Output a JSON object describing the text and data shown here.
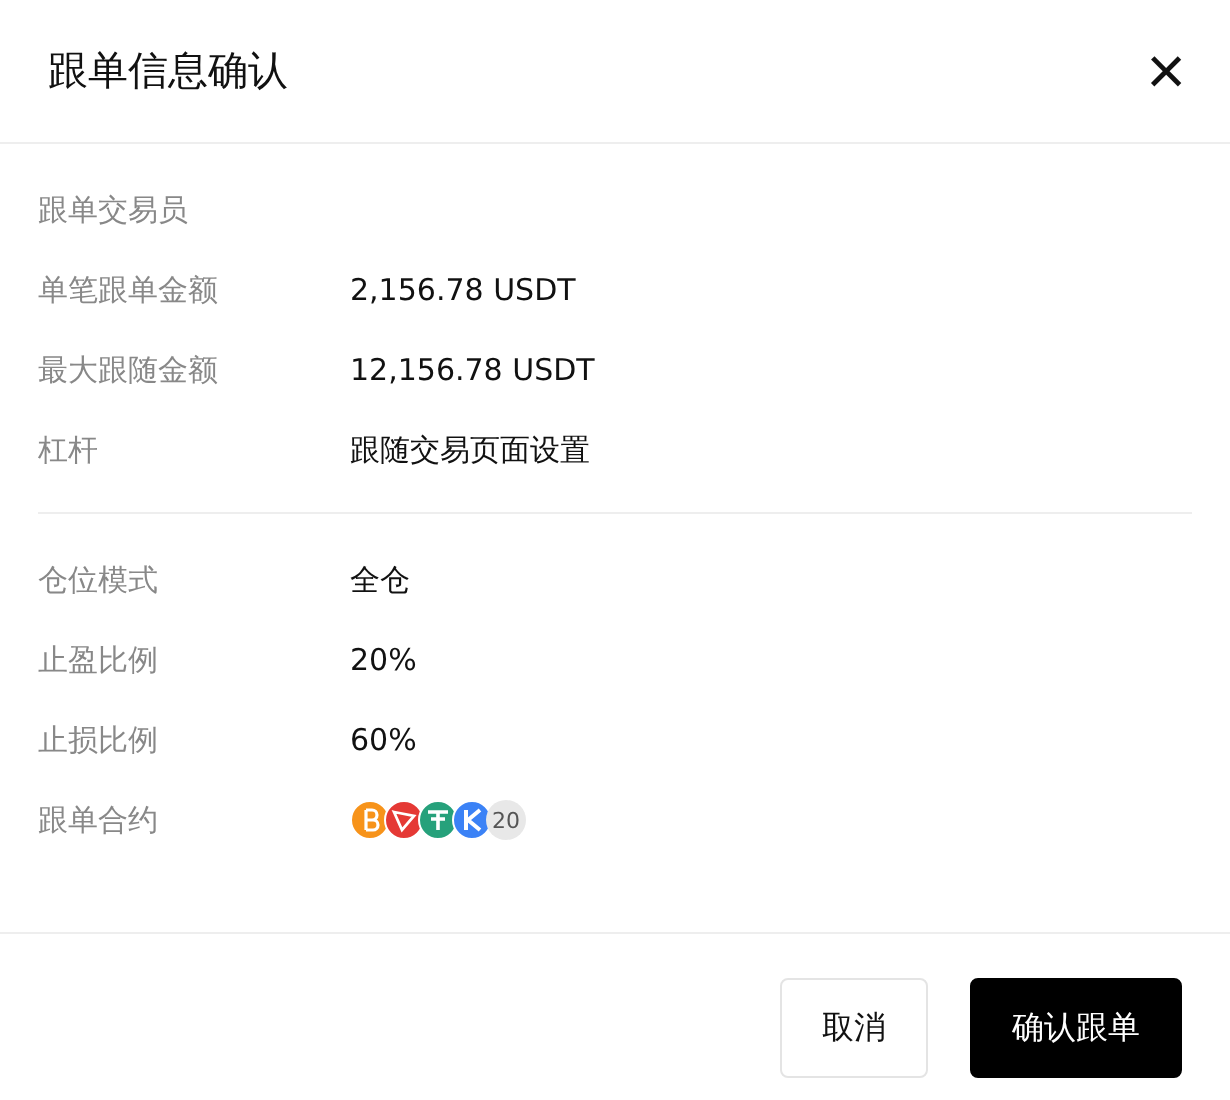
{
  "dialog": {
    "title": "跟单信息确认",
    "close": "×"
  },
  "sections": [
    {
      "rows": [
        {
          "label": "跟单交易员"
        },
        {
          "label": "单笔跟单金额",
          "value": "2,156.78 USDT"
        },
        {
          "label": "最大跟随金额",
          "value": "12,156.78 USDT"
        },
        {
          "label": "杠杆",
          "value": "跟随交易页面设置"
        }
      ]
    },
    {
      "rows": [
        {
          "label": "仓位模式",
          "value": "全仓"
        },
        {
          "label": "止盈比例",
          "value": "20%"
        },
        {
          "label": "止损比例",
          "value": "60%"
        },
        {
          "label": "跟单合约",
          "coins": [
            {
              "color": "#f7931a"
            },
            {
              "color": "#e53935"
            },
            {
              "color": "#26a17b"
            },
            {
              "color": "#3b82f6"
            }
          ],
          "count": "20"
        }
      ]
    }
  ],
  "buttons": [
    {
      "label": "取消",
      "kind": "secondary"
    },
    {
      "label": "确认跟单",
      "kind": "primary"
    }
  ]
}
